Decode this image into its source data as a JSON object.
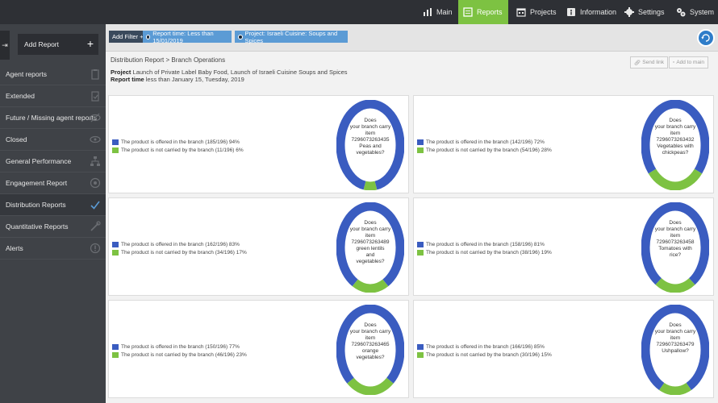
{
  "nav": {
    "items": [
      {
        "label": "Main",
        "icon": "chart-icon"
      },
      {
        "label": "Reports",
        "icon": "reports-icon"
      },
      {
        "label": "Projects",
        "icon": "calendar-icon"
      },
      {
        "label": "Information",
        "icon": "info-book-icon"
      },
      {
        "label": "Settings",
        "icon": "gear-icon"
      },
      {
        "label": "System",
        "icon": "system-gear-icon"
      }
    ],
    "active": "Reports",
    "active_color": "#7dc242"
  },
  "sidebar": {
    "add_report_label": "Add Report",
    "items": [
      {
        "label": "Agent reports"
      },
      {
        "label": "Extended"
      },
      {
        "label": "Future / Missing agent reports"
      },
      {
        "label": "Closed"
      },
      {
        "label": "General Performance"
      },
      {
        "label": "Engagement Report"
      },
      {
        "label": "Distribution Reports"
      },
      {
        "label": "Quantitative Reports"
      },
      {
        "label": "Alerts"
      }
    ],
    "active": "Distribution Reports"
  },
  "filters": {
    "add_filter": "Add Filter +",
    "time_filter": "Report time: Less than 15/01/2019",
    "project_filter": "Project: Israeli Cuisine: Soups and Spices"
  },
  "report": {
    "breadcrumb": "Distribution Report > Branch Operations",
    "project_label": "Project",
    "project_value": "Launch of Private Label Baby Food, Launch of Israeli Cuisine Soups and Spices",
    "time_label": "Report time",
    "time_value": "less than January 15, Tuesday, 2019",
    "send_link": "Send link",
    "add_to_main": "Add to main"
  },
  "colors": {
    "offered": "#3a5cc0",
    "not_carried": "#7dc242"
  },
  "cards": [
    {
      "offered_label": "The product is offered in the branch (185/196) 94%",
      "not_label": "The product is not carried by the branch (11/196) 6%",
      "offered_fraction": 0.94,
      "question": [
        "Does",
        "your branch carry",
        "item",
        "7296073263435",
        "Peas and",
        "vegetables?"
      ]
    },
    {
      "offered_label": "The product is offered in the branch (142/196) 72%",
      "not_label": "The product is not carried by the branch (54/196) 28%",
      "offered_fraction": 0.72,
      "question": [
        "Does",
        "your branch carry",
        "item",
        "7296073263432",
        "Vegetables with",
        "chickpeas?"
      ]
    },
    {
      "offered_label": "The product is offered in the branch (162/196) 83%",
      "not_label": "The product is not carried by the branch (34/196) 17%",
      "offered_fraction": 0.83,
      "question": [
        "Does",
        "your branch carry",
        "item",
        "7296073263489",
        "green lentils",
        "and",
        "vegetables?"
      ]
    },
    {
      "offered_label": "The product is offered in the branch (158/196) 81%",
      "not_label": "The product is not carried by the branch (38/196) 19%",
      "offered_fraction": 0.81,
      "question": [
        "Does",
        "your branch carry",
        "item",
        "7296073263458",
        "Tomatoes with",
        "rice?"
      ]
    },
    {
      "offered_label": "The product is offered in the branch (150/196) 77%",
      "not_label": "The product is not carried by the branch (46/196) 23%",
      "offered_fraction": 0.77,
      "question": [
        "Does",
        "your branch carry",
        "item",
        "7296073263465",
        "orange",
        "vegetables?"
      ]
    },
    {
      "offered_label": "The product is offered in the branch (166/196) 85%",
      "not_label": "The product is not carried by the branch (30/196) 15%",
      "offered_fraction": 0.85,
      "question": [
        "Does",
        "your branch carry",
        "item",
        "7296073263479",
        "Ushpallow?"
      ]
    }
  ]
}
